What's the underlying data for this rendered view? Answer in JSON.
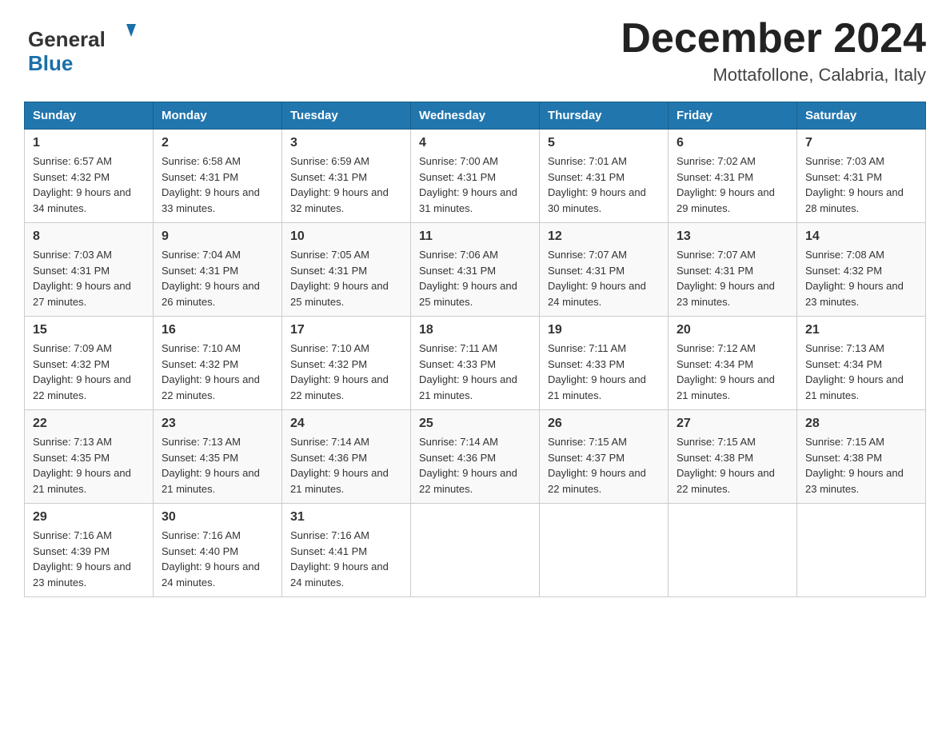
{
  "header": {
    "logo_text_general": "General",
    "logo_text_blue": "Blue",
    "month_title": "December 2024",
    "subtitle": "Mottafollone, Calabria, Italy"
  },
  "days_of_week": [
    "Sunday",
    "Monday",
    "Tuesday",
    "Wednesday",
    "Thursday",
    "Friday",
    "Saturday"
  ],
  "weeks": [
    [
      {
        "day": "1",
        "sunrise": "6:57 AM",
        "sunset": "4:32 PM",
        "daylight": "9 hours and 34 minutes."
      },
      {
        "day": "2",
        "sunrise": "6:58 AM",
        "sunset": "4:31 PM",
        "daylight": "9 hours and 33 minutes."
      },
      {
        "day": "3",
        "sunrise": "6:59 AM",
        "sunset": "4:31 PM",
        "daylight": "9 hours and 32 minutes."
      },
      {
        "day": "4",
        "sunrise": "7:00 AM",
        "sunset": "4:31 PM",
        "daylight": "9 hours and 31 minutes."
      },
      {
        "day": "5",
        "sunrise": "7:01 AM",
        "sunset": "4:31 PM",
        "daylight": "9 hours and 30 minutes."
      },
      {
        "day": "6",
        "sunrise": "7:02 AM",
        "sunset": "4:31 PM",
        "daylight": "9 hours and 29 minutes."
      },
      {
        "day": "7",
        "sunrise": "7:03 AM",
        "sunset": "4:31 PM",
        "daylight": "9 hours and 28 minutes."
      }
    ],
    [
      {
        "day": "8",
        "sunrise": "7:03 AM",
        "sunset": "4:31 PM",
        "daylight": "9 hours and 27 minutes."
      },
      {
        "day": "9",
        "sunrise": "7:04 AM",
        "sunset": "4:31 PM",
        "daylight": "9 hours and 26 minutes."
      },
      {
        "day": "10",
        "sunrise": "7:05 AM",
        "sunset": "4:31 PM",
        "daylight": "9 hours and 25 minutes."
      },
      {
        "day": "11",
        "sunrise": "7:06 AM",
        "sunset": "4:31 PM",
        "daylight": "9 hours and 25 minutes."
      },
      {
        "day": "12",
        "sunrise": "7:07 AM",
        "sunset": "4:31 PM",
        "daylight": "9 hours and 24 minutes."
      },
      {
        "day": "13",
        "sunrise": "7:07 AM",
        "sunset": "4:31 PM",
        "daylight": "9 hours and 23 minutes."
      },
      {
        "day": "14",
        "sunrise": "7:08 AM",
        "sunset": "4:32 PM",
        "daylight": "9 hours and 23 minutes."
      }
    ],
    [
      {
        "day": "15",
        "sunrise": "7:09 AM",
        "sunset": "4:32 PM",
        "daylight": "9 hours and 22 minutes."
      },
      {
        "day": "16",
        "sunrise": "7:10 AM",
        "sunset": "4:32 PM",
        "daylight": "9 hours and 22 minutes."
      },
      {
        "day": "17",
        "sunrise": "7:10 AM",
        "sunset": "4:32 PM",
        "daylight": "9 hours and 22 minutes."
      },
      {
        "day": "18",
        "sunrise": "7:11 AM",
        "sunset": "4:33 PM",
        "daylight": "9 hours and 21 minutes."
      },
      {
        "day": "19",
        "sunrise": "7:11 AM",
        "sunset": "4:33 PM",
        "daylight": "9 hours and 21 minutes."
      },
      {
        "day": "20",
        "sunrise": "7:12 AM",
        "sunset": "4:34 PM",
        "daylight": "9 hours and 21 minutes."
      },
      {
        "day": "21",
        "sunrise": "7:13 AM",
        "sunset": "4:34 PM",
        "daylight": "9 hours and 21 minutes."
      }
    ],
    [
      {
        "day": "22",
        "sunrise": "7:13 AM",
        "sunset": "4:35 PM",
        "daylight": "9 hours and 21 minutes."
      },
      {
        "day": "23",
        "sunrise": "7:13 AM",
        "sunset": "4:35 PM",
        "daylight": "9 hours and 21 minutes."
      },
      {
        "day": "24",
        "sunrise": "7:14 AM",
        "sunset": "4:36 PM",
        "daylight": "9 hours and 21 minutes."
      },
      {
        "day": "25",
        "sunrise": "7:14 AM",
        "sunset": "4:36 PM",
        "daylight": "9 hours and 22 minutes."
      },
      {
        "day": "26",
        "sunrise": "7:15 AM",
        "sunset": "4:37 PM",
        "daylight": "9 hours and 22 minutes."
      },
      {
        "day": "27",
        "sunrise": "7:15 AM",
        "sunset": "4:38 PM",
        "daylight": "9 hours and 22 minutes."
      },
      {
        "day": "28",
        "sunrise": "7:15 AM",
        "sunset": "4:38 PM",
        "daylight": "9 hours and 23 minutes."
      }
    ],
    [
      {
        "day": "29",
        "sunrise": "7:16 AM",
        "sunset": "4:39 PM",
        "daylight": "9 hours and 23 minutes."
      },
      {
        "day": "30",
        "sunrise": "7:16 AM",
        "sunset": "4:40 PM",
        "daylight": "9 hours and 24 minutes."
      },
      {
        "day": "31",
        "sunrise": "7:16 AM",
        "sunset": "4:41 PM",
        "daylight": "9 hours and 24 minutes."
      },
      null,
      null,
      null,
      null
    ]
  ]
}
